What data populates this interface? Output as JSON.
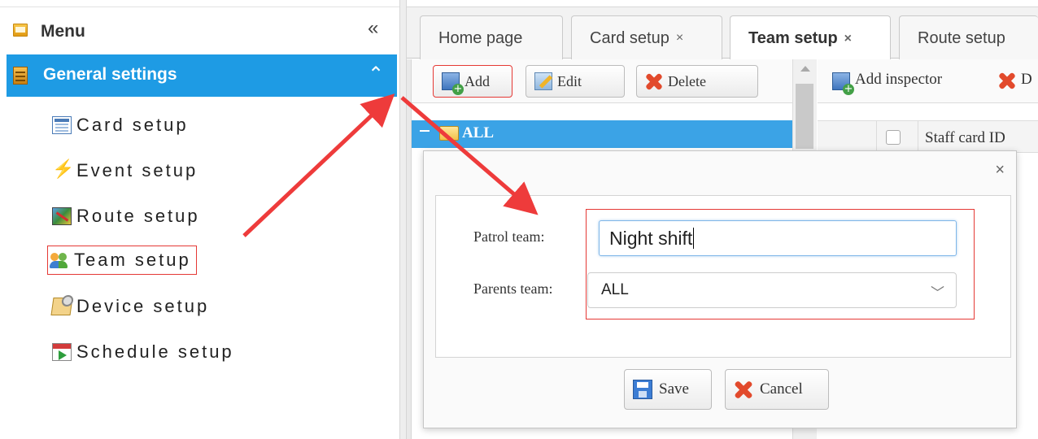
{
  "sidebar": {
    "menu_title": "Menu",
    "collapse_glyph": "«",
    "group_title": "General settings",
    "group_toggle_glyph": "⌃",
    "items": [
      {
        "label": "Card setup",
        "icon": "card-icon"
      },
      {
        "label": "Event setup",
        "icon": "lightning-icon"
      },
      {
        "label": "Route setup",
        "icon": "map-icon"
      },
      {
        "label": "Team setup",
        "icon": "team-icon"
      },
      {
        "label": "Device setup",
        "icon": "device-icon"
      },
      {
        "label": "Schedule setup",
        "icon": "calendar-icon"
      }
    ],
    "active_item": "Team setup"
  },
  "tabs": [
    {
      "label": "Home page",
      "closable": false
    },
    {
      "label": "Card setup",
      "closable": true
    },
    {
      "label": "Team setup",
      "closable": true,
      "active": true
    },
    {
      "label": "Route setup",
      "closable": false
    }
  ],
  "tab_close_glyph": "×",
  "left_toolbar": {
    "add_label": "Add",
    "edit_label": "Edit",
    "delete_label": "Delete"
  },
  "tree": {
    "root_label": "ALL"
  },
  "right_toolbar": {
    "add_inspector_label": "Add inspector",
    "delete_label_partial": "D"
  },
  "grid": {
    "columns": [
      "Staff card ID"
    ]
  },
  "dialog": {
    "close_glyph": "×",
    "patrol_team_label": "Patrol team:",
    "patrol_team_value": "Night shift",
    "parents_team_label": "Parents team:",
    "parents_team_value": "ALL",
    "save_label": "Save",
    "cancel_label": "Cancel"
  },
  "colors": {
    "accent": "#1e9be4",
    "tree_selected": "#3ba3e6",
    "highlight_box": "#e53935"
  }
}
